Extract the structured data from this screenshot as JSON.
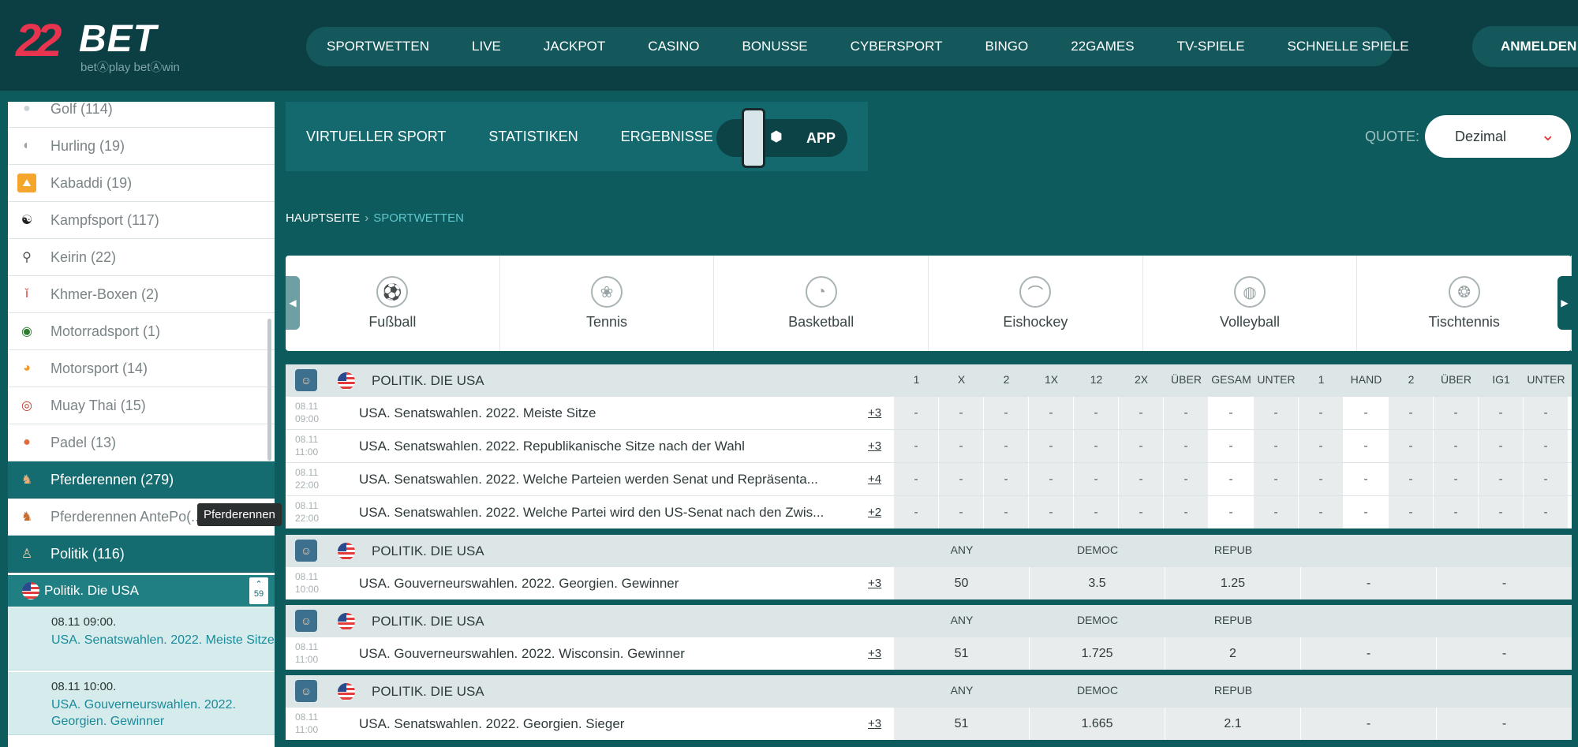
{
  "header": {
    "logo_main": "22",
    "logo_bet": "BET",
    "logo_tagline": "betⒶplay  betⒶwin",
    "nav": [
      "SPORTWETTEN",
      "LIVE",
      "JACKPOT",
      "CASINO",
      "BONUSSE",
      "CYBERSPORT",
      "BINGO",
      "22GAMES",
      "TV-SPIELE",
      "SCHNELLE SPIELE"
    ],
    "login": "ANMELDEN"
  },
  "sidebar": {
    "items": [
      {
        "label": "Golf (114)",
        "icon": "golf-icon"
      },
      {
        "label": "Hurling (19)",
        "icon": "hurling-icon"
      },
      {
        "label": "Kabaddi (19)",
        "icon": "kabaddi-icon"
      },
      {
        "label": "Kampfsport (117)",
        "icon": "martial-arts-icon"
      },
      {
        "label": "Keirin (22)",
        "icon": "bicycle-icon"
      },
      {
        "label": "Khmer-Boxen (2)",
        "icon": "boxer-icon"
      },
      {
        "label": "Motorradsport (1)",
        "icon": "motorcycle-icon"
      },
      {
        "label": "Motorsport (14)",
        "icon": "motorsport-icon"
      },
      {
        "label": "Muay Thai (15)",
        "icon": "muay-thai-icon"
      },
      {
        "label": "Padel (13)",
        "icon": "padel-icon"
      },
      {
        "label": "Pferderennen (279)",
        "icon": "horse-racing-icon"
      },
      {
        "label": "Pferderennen AntePo(...)",
        "icon": "horse-racing-icon"
      },
      {
        "label": "Politik (116)",
        "icon": "politics-icon"
      }
    ],
    "sub_label": "Politik. Die USA",
    "sub_count": "59",
    "events": [
      {
        "time": "08.11 09:00.",
        "name": "USA. Senatswahlen. 2022. Meiste Sitze"
      },
      {
        "time": "08.11 10:00.",
        "name": "USA. Gouverneurswahlen. 2022. Georgien. Gewinner"
      }
    ],
    "tooltip": "Pferderennen"
  },
  "subnav": {
    "items": [
      "VIRTUELLER SPORT",
      "STATISTIKEN",
      "ERGEBNISSE"
    ],
    "app_label": "APP"
  },
  "quote": {
    "label": "QUOTE:",
    "value": "Dezimal"
  },
  "breadcrumb": {
    "home": "HAUPTSEITE",
    "current": "SPORTWETTEN"
  },
  "sports": [
    {
      "label": "Fußball",
      "icon": "football-icon",
      "glyph": "⚽"
    },
    {
      "label": "Tennis",
      "icon": "tennis-icon",
      "glyph": "❀"
    },
    {
      "label": "Basketball",
      "icon": "basketball-icon",
      "glyph": "◔"
    },
    {
      "label": "Eishockey",
      "icon": "ice-hockey-icon",
      "glyph": "⌒"
    },
    {
      "label": "Volleyball",
      "icon": "volleyball-icon",
      "glyph": "◍"
    },
    {
      "label": "Tischtennis",
      "icon": "table-tennis-icon",
      "glyph": "❂"
    }
  ],
  "group1": {
    "title": "POLITIK. DIE USA",
    "columns": [
      "1",
      "X",
      "2",
      "1X",
      "12",
      "2X",
      "ÜBER",
      "GESAM",
      "UNTER",
      "1",
      "HAND",
      "2",
      "ÜBER",
      "IG1",
      "UNTER"
    ],
    "rows": [
      {
        "date": "08.11",
        "time": "09:00",
        "name": "USA. Senatswahlen. 2022. Meiste Sitze",
        "more": "+3"
      },
      {
        "date": "08.11",
        "time": "11:00",
        "name": "USA. Senatswahlen. 2022. Republikanische Sitze nach der Wahl",
        "more": "+3"
      },
      {
        "date": "08.11",
        "time": "22:00",
        "name": "USA. Senatswahlen. 2022. Welche Parteien werden Senat und Repräsenta...",
        "more": "+4"
      },
      {
        "date": "08.11",
        "time": "22:00",
        "name": "USA. Senatswahlen. 2022. Welche Partei wird den US-Senat nach den Zwis...",
        "more": "+2"
      }
    ],
    "empty_value": "-"
  },
  "groups": [
    {
      "title": "POLITIK. DIE USA",
      "cols": [
        "ANY",
        "DEMOC",
        "REPUB"
      ],
      "date": "08.11",
      "time": "10:00",
      "name": "USA. Gouverneurswahlen. 2022. Georgien. Gewinner",
      "more": "+3",
      "odds": [
        "50",
        "3.5",
        "1.25",
        "-",
        "-"
      ]
    },
    {
      "title": "POLITIK. DIE USA",
      "cols": [
        "ANY",
        "DEMOC",
        "REPUB"
      ],
      "date": "08.11",
      "time": "11:00",
      "name": "USA. Gouverneurswahlen. 2022. Wisconsin. Gewinner",
      "more": "+3",
      "odds": [
        "51",
        "1.725",
        "2",
        "-",
        "-"
      ]
    },
    {
      "title": "POLITIK. DIE USA",
      "cols": [
        "ANY",
        "DEMOC",
        "REPUB"
      ],
      "date": "08.11",
      "time": "11:00",
      "name": "USA. Senatswahlen. 2022. Georgien. Sieger",
      "more": "+3",
      "odds": [
        "51",
        "1.665",
        "2.1",
        "-",
        "-"
      ]
    }
  ],
  "colors": {
    "bg": "#0e5b5d",
    "header": "#0b3f43",
    "active": "#146c70",
    "accent": "#e03a3a",
    "link": "#1a8a9a"
  }
}
